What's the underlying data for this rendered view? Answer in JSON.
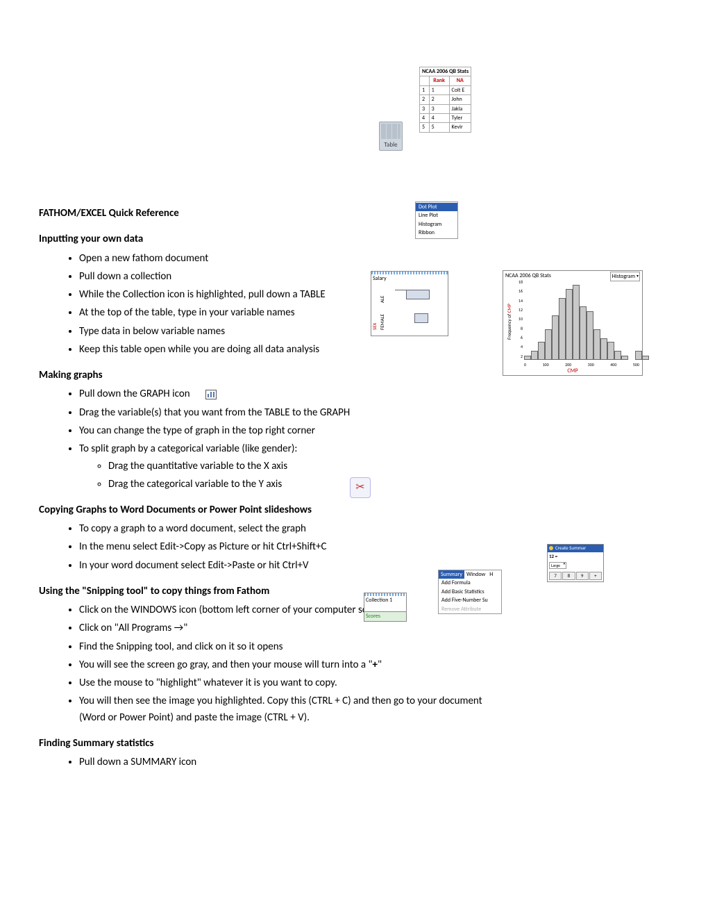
{
  "title": "FATHOM/EXCEL Quick Reference",
  "sections": {
    "s1": {
      "heading": "Inputting your own data",
      "items": [
        "Open a new fathom document",
        "Pull down a collection",
        "While the Collection icon is highlighted, pull down a TABLE",
        "At the top of the table, type in your variable names",
        "Type data in below variable names",
        "Keep this table open while you are doing all data analysis"
      ]
    },
    "s2": {
      "heading": "Making graphs",
      "items": [
        "Pull down the GRAPH icon",
        "Drag the variable(s) that you want from the TABLE to the GRAPH",
        "You can change the type of graph in the top right corner",
        "To split graph by a categorical variable (like gender):"
      ],
      "sub": [
        "Drag the quantitative variable to the X axis",
        "Drag the categorical variable to the Y axis"
      ]
    },
    "s3": {
      "heading": "Copying Graphs to Word Documents or Power Point slideshows",
      "items": [
        "To copy a graph to a word document, select the graph",
        "In the menu select Edit->Copy as Picture or hit Ctrl+Shift+C",
        "In your word document select Edit->Paste or hit Ctrl+V"
      ]
    },
    "s4": {
      "heading": "Using the \"Snipping tool\" to copy things from Fathom",
      "items": [
        "Click on the WINDOWS icon (bottom left corner of your computer screen",
        "Click on \"All Programs →\"",
        "Find the Snipping tool, and click on it so it opens",
        "You will see the screen go gray, and then your mouse will turn into a \"+\"",
        "Use the mouse to \"highlight\" whatever it is you want to copy.",
        "You will then see the image you highlighted.  Copy this (CTRL + C) and then go to your document (Word or Power Point) and paste the image (CTRL + V)."
      ],
      "bold_plus": "+"
    },
    "s5": {
      "heading": "Finding Summary statistics",
      "items": [
        "Pull down a SUMMARY icon"
      ]
    }
  },
  "icons": {
    "table_label": "Table"
  },
  "ncaa_table": {
    "title": "NCAA 2006 QB Stats",
    "cols": [
      "",
      "Rank",
      "NA"
    ],
    "rows": [
      [
        "1",
        "1",
        "Colt E"
      ],
      [
        "2",
        "2",
        "John"
      ],
      [
        "3",
        "3",
        "Jakla"
      ],
      [
        "4",
        "4",
        "Tyler"
      ],
      [
        "5",
        "5",
        "Kevir"
      ]
    ]
  },
  "graph_menu": {
    "items": [
      "Dot Plot",
      "Line Plot",
      "Histogram",
      "Ribbon"
    ],
    "selected": "Dot Plot"
  },
  "split_box": {
    "top": "Salary",
    "side": "SEX",
    "cats": [
      "FEMALE",
      "ALE"
    ]
  },
  "hist_box": {
    "title": "NCAA 2006 QB Stats",
    "dropdown": "Histogram",
    "ylabel": "Frequency of CMP",
    "xlabel": "CMP"
  },
  "chart_data": {
    "type": "bar",
    "title": "NCAA 2006 QB Stats",
    "xlabel": "CMP",
    "ylabel": "Frequency of CMP",
    "x_ticks": [
      0,
      100,
      200,
      300,
      400,
      500
    ],
    "y_ticks": [
      2,
      4,
      6,
      8,
      10,
      12,
      14,
      16,
      18
    ],
    "ylim": [
      0,
      18
    ],
    "bin_edges": [
      60,
      80,
      100,
      120,
      140,
      160,
      180,
      200,
      220,
      240,
      260,
      280,
      300,
      320,
      340,
      360,
      380,
      400,
      480,
      500
    ],
    "values": [
      1,
      2,
      4,
      7,
      10,
      14,
      16,
      17,
      12,
      11,
      7,
      5,
      4,
      2,
      1,
      1,
      1,
      0,
      2,
      1
    ]
  },
  "coll_box": {
    "name": "Collection 1",
    "tab": "Scores"
  },
  "summary_menu": {
    "bar": [
      "Summary",
      "Window",
      "H"
    ],
    "items": [
      "Add Formula",
      "Add Basic Statistics",
      "Add Five-Number Su"
    ],
    "disabled": "Remove Attribute"
  },
  "create_sum": {
    "title": "Create Summar",
    "val": "12 =",
    "drop": "Large",
    "keys": [
      "7",
      "8",
      "9",
      "+"
    ]
  }
}
